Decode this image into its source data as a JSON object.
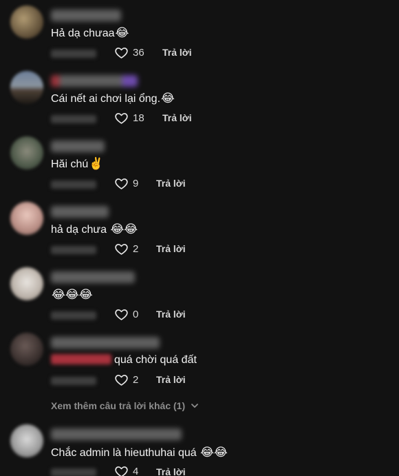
{
  "reply_label": "Trả lời",
  "comments": [
    {
      "text": "Hả dạ chưaa",
      "emoji": "😂",
      "likes": "36"
    },
    {
      "text": "Cái nết ai chơi lại ổng.",
      "emoji": "😂",
      "likes": "18"
    },
    {
      "text": "Hăi chú",
      "emoji": "✌️",
      "likes": "9"
    },
    {
      "text": "hả dạ chưa ",
      "emoji": "😂😂",
      "likes": "2"
    },
    {
      "text": "",
      "emoji": "😂😂😂",
      "likes": "0"
    },
    {
      "text": "quá chời quá đất",
      "emoji": "",
      "likes": "2"
    },
    {
      "text": "Chắc admin là hieuthuhai quá ",
      "emoji": "😂😂",
      "likes": "4"
    }
  ],
  "view_more_label": "Xem thêm câu trả lời khác (1)",
  "colors": {
    "background": "#121212",
    "text": "#f2f2f2",
    "muted": "#8d8d8d",
    "mention": "#a8323d"
  },
  "icons": {
    "like": "heart-outline-icon",
    "expand": "chevron-down-icon"
  }
}
